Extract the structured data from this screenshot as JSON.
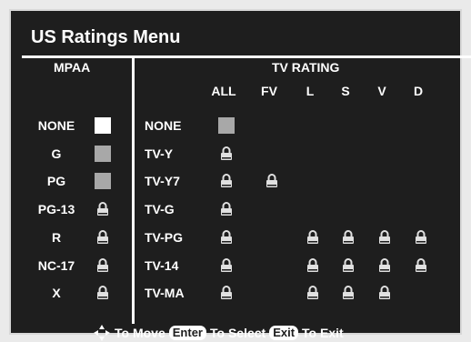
{
  "title": "US Ratings Menu",
  "mpaa": {
    "header": "MPAA",
    "items": [
      {
        "label": "NONE",
        "state": "unlocked-selected"
      },
      {
        "label": "G",
        "state": "unlocked"
      },
      {
        "label": "PG",
        "state": "unlocked"
      },
      {
        "label": "PG-13",
        "state": "locked"
      },
      {
        "label": "R",
        "state": "locked"
      },
      {
        "label": "NC-17",
        "state": "locked"
      },
      {
        "label": "X",
        "state": "locked"
      }
    ]
  },
  "tv": {
    "header": "TV RATING",
    "columns": [
      "ALL",
      "FV",
      "L",
      "S",
      "V",
      "D"
    ],
    "rows": [
      {
        "label": "NONE",
        "cells": [
          "unlocked",
          null,
          null,
          null,
          null,
          null
        ]
      },
      {
        "label": "TV-Y",
        "cells": [
          "locked",
          null,
          null,
          null,
          null,
          null
        ]
      },
      {
        "label": "TV-Y7",
        "cells": [
          "locked",
          "locked",
          null,
          null,
          null,
          null
        ]
      },
      {
        "label": "TV-G",
        "cells": [
          "locked",
          null,
          null,
          null,
          null,
          null
        ]
      },
      {
        "label": "TV-PG",
        "cells": [
          "locked",
          null,
          "locked",
          "locked",
          "locked",
          "locked"
        ]
      },
      {
        "label": "TV-14",
        "cells": [
          "locked",
          null,
          "locked",
          "locked",
          "locked",
          "locked"
        ]
      },
      {
        "label": "TV-MA",
        "cells": [
          "locked",
          null,
          "locked",
          "locked",
          "locked",
          null
        ]
      }
    ]
  },
  "footer": {
    "move_text": "To Move",
    "enter_key": "Enter",
    "select_text": "To Select",
    "exit_key": "Exit",
    "exit_text": "To Exit"
  },
  "colors": {
    "background": "#1e1e1e",
    "text": "#ffffff",
    "unlocked_box": "#a8a8a8",
    "selected_box": "#ffffff"
  }
}
